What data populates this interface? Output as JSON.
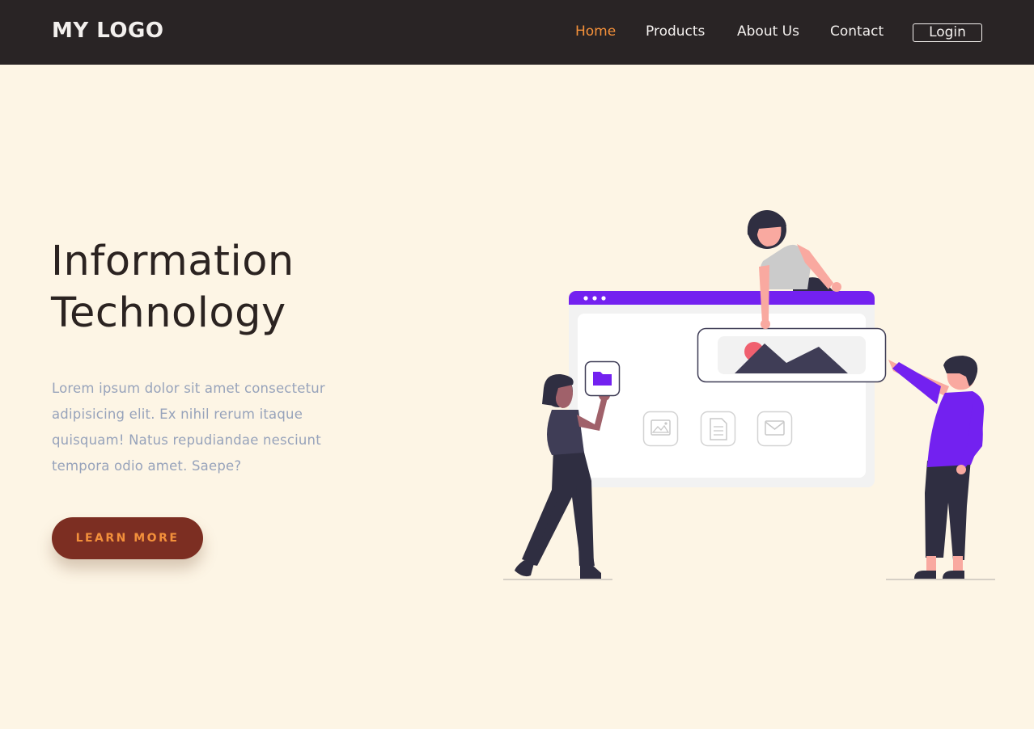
{
  "header": {
    "logo": "MY LOGO",
    "nav": [
      {
        "label": "Home",
        "active": true
      },
      {
        "label": "Products",
        "active": false
      },
      {
        "label": "About Us",
        "active": false
      },
      {
        "label": "Contact",
        "active": false
      }
    ],
    "login_label": "Login"
  },
  "hero": {
    "title_line1": "Information",
    "title_line2": "Technology",
    "description": "Lorem ipsum dolor sit amet consectetur adipisicing elit. Ex nihil rerum itaque quisquam! Natus repudiandae nesciunt tempora odio amet. Saepe?",
    "cta_label": "LEARN MORE"
  },
  "illustration": {
    "icons": [
      "folder-icon",
      "image-icon",
      "document-icon",
      "mail-icon"
    ]
  },
  "colors": {
    "background": "#fdf5e5",
    "navbar": "#292425",
    "accent": "#f5913a",
    "cta_background": "#7c2e22",
    "illustration_purple": "#7321f0"
  }
}
